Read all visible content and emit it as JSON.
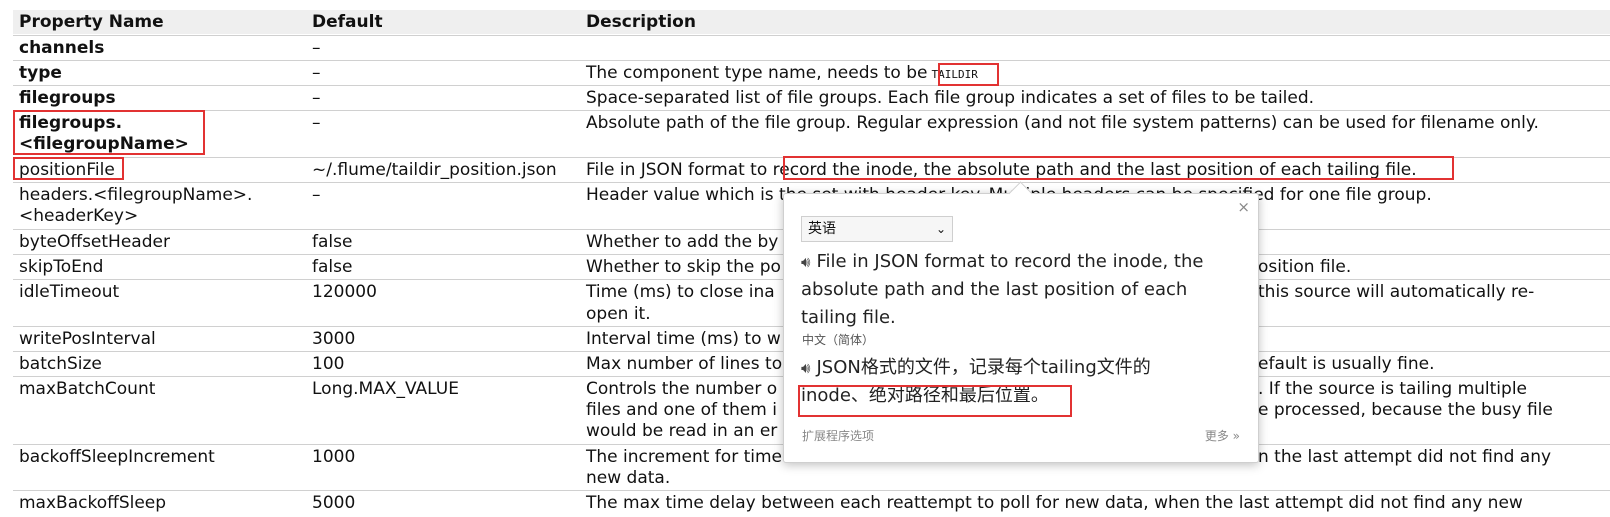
{
  "table": {
    "headers": {
      "name": "Property Name",
      "default": "Default",
      "description": "Description"
    },
    "rows": [
      {
        "name": "channels",
        "default": "–",
        "desc": ""
      },
      {
        "name": "type",
        "default": "–",
        "desc": "The component type name, needs to be",
        "code": "TAILDIR"
      },
      {
        "name": "filegroups",
        "default": "–",
        "desc": "Space-separated list of file groups. Each file group indicates a set of files to be tailed."
      },
      {
        "name": "filegroups.<filegroupName>",
        "default": "–",
        "desc": "Absolute path of the file group. Regular expression (and not file system patterns) can be used for filename only."
      },
      {
        "name": "positionFile",
        "default": "~/.flume/taildir_position.json",
        "desc": "File in JSON format to record the inode, the absolute path and the last position of each tailing file."
      },
      {
        "name": "headers.<filegroupName>.<headerKey>",
        "default": "–",
        "desc": "Header value which is the set with header key. Multiple headers can be specified for one file group."
      },
      {
        "name": "byteOffsetHeader",
        "default": "false",
        "desc": "Whether to add the by"
      },
      {
        "name": "skipToEnd",
        "default": "false",
        "desc": "Whether to skip the po",
        "desc_right": "osition file."
      },
      {
        "name": "idleTimeout",
        "default": "120000",
        "desc": "Time (ms) to close ina",
        "desc_right": "this source will automatically re-",
        "desc2": "open it."
      },
      {
        "name": "writePosInterval",
        "default": "3000",
        "desc": "Interval time (ms) to w"
      },
      {
        "name": "batchSize",
        "default": "100",
        "desc": "Max number of lines to",
        "desc_right": "efault is usually fine."
      },
      {
        "name": "maxBatchCount",
        "default": "Long.MAX_VALUE",
        "desc": "Controls the number o",
        "desc2": "files and one of them i",
        "desc3": "would be read in an er",
        "desc_right": ". If the source is tailing multiple",
        "desc_right2": "e processed, because the busy file"
      },
      {
        "name": "backoffSleepIncrement",
        "default": "1000",
        "desc": "The increment for time",
        "desc2": "new data.",
        "desc_right": "n the last attempt did not find any"
      },
      {
        "name": "maxBackoffSleep",
        "default": "5000",
        "desc": "The max time delay between each reattempt to poll for new data, when the last attempt did not find any new"
      }
    ]
  },
  "popup": {
    "source_lang": "英语",
    "source_text": "File in JSON format to record the inode, the absolute path and the last position of each tailing file.",
    "target_lang": "中文（简体）",
    "target_text_line1": "JSON格式的文件，记录每个tailing文件的",
    "target_text_line2": "inode、绝对路径和最后位置。",
    "footer_left": "扩展程序选项",
    "footer_right": "更多 »",
    "close": "×"
  }
}
